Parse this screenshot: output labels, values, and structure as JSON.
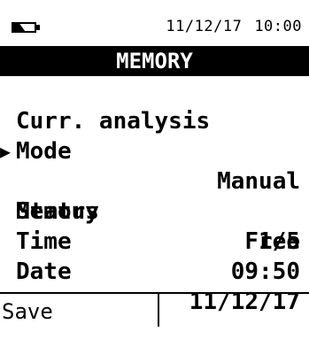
{
  "status_bar": {
    "battery_icon": "battery-icon",
    "battery_level": 0.55,
    "date": "11/12/17",
    "time": "10:00"
  },
  "title": "MEMORY",
  "rows": [
    {
      "label": "Curr. analysis",
      "value": ""
    },
    {
      "label": "Mode",
      "value": "Manual"
    },
    {
      "label": "Memory",
      "value": "1/5",
      "selected": true
    },
    {
      "label": "Status",
      "value": "Free"
    },
    {
      "label": "Time",
      "value": "09:50"
    },
    {
      "label": "Date",
      "value": "11/12/17"
    }
  ],
  "selection_pointer": "▶",
  "softkeys": {
    "left": "Save",
    "right": ""
  },
  "colors": {
    "background": "#ffffff",
    "foreground": "#000000",
    "title_bg": "#000000",
    "title_fg": "#ffffff"
  }
}
